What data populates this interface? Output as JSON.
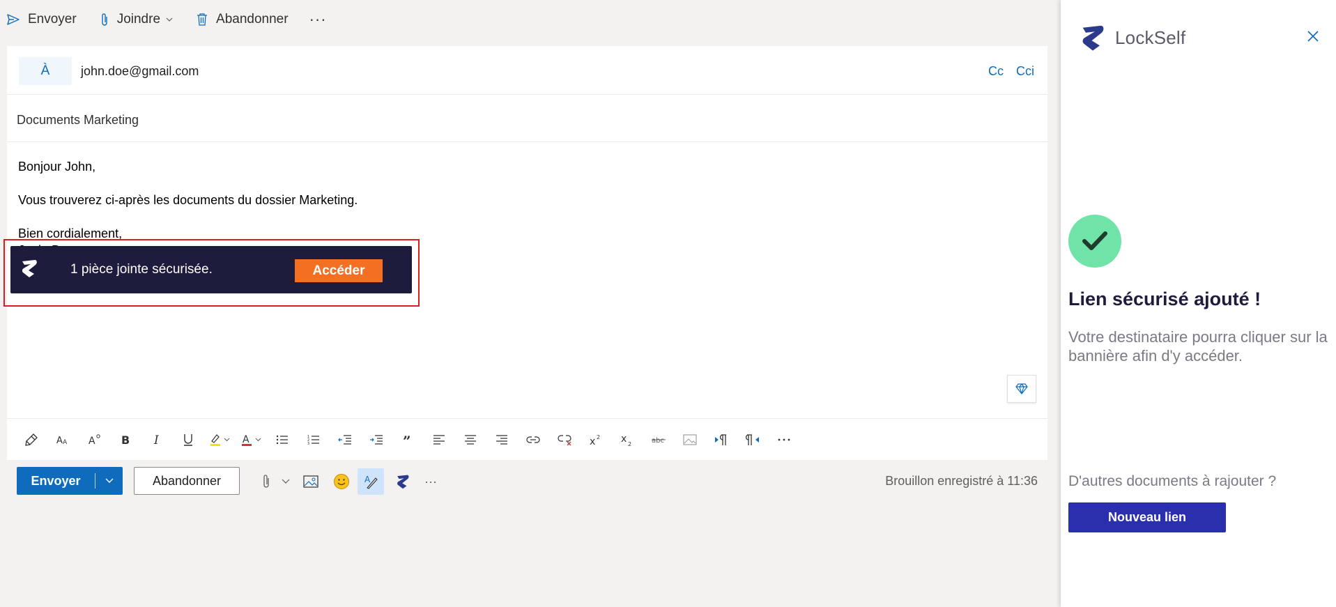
{
  "topbar": {
    "send_label": "Envoyer",
    "attach_label": "Joindre",
    "discard_label": "Abandonner",
    "more_label": "···"
  },
  "header": {
    "to_label": "À",
    "to_value": "john.doe@gmail.com",
    "cc_label": "Cc",
    "bcc_label": "Cci",
    "subject": "Documents Marketing"
  },
  "body": {
    "lines": [
      "Bonjour John,",
      "Vous trouverez ci-après les documents du dossier Marketing.",
      "Bien cordialement,",
      "Janie Doe"
    ]
  },
  "banner": {
    "text": "1 pièce jointe sécurisée.",
    "button_label": "Accéder",
    "background": "#1e1c3d",
    "button_color": "#f36f21"
  },
  "format_toolbar": {
    "icons": [
      "format-painter-icon",
      "font-size-icon",
      "text-effects-icon",
      "bold-icon",
      "italic-icon",
      "underline-icon",
      "highlight-icon",
      "font-color-icon",
      "bullets-icon",
      "numbering-icon",
      "decrease-indent-icon",
      "increase-indent-icon",
      "quote-icon",
      "align-left-icon",
      "align-center-icon",
      "align-right-icon",
      "link-icon",
      "unlink-icon",
      "superscript-icon",
      "subscript-icon",
      "strikethrough-icon",
      "image-icon",
      "ltr-icon",
      "rtl-icon",
      "more-icon"
    ]
  },
  "action_bar": {
    "send_label": "Envoyer",
    "discard_label": "Abandonner",
    "draft_status": "Brouillon enregistré à 11:36",
    "more_label": "···",
    "accent": "#0f6cbd"
  },
  "panel": {
    "brand": "LockSelf",
    "title": "Lien sécurisé ajouté !",
    "description": "Votre destinataire pourra cliquer sur la bannière afin d'y accéder.",
    "question": "D'autres documents à rajouter ?",
    "new_link_label": "Nouveau lien",
    "button_color": "#2a2fae",
    "check_color": "#6fe3a8"
  }
}
